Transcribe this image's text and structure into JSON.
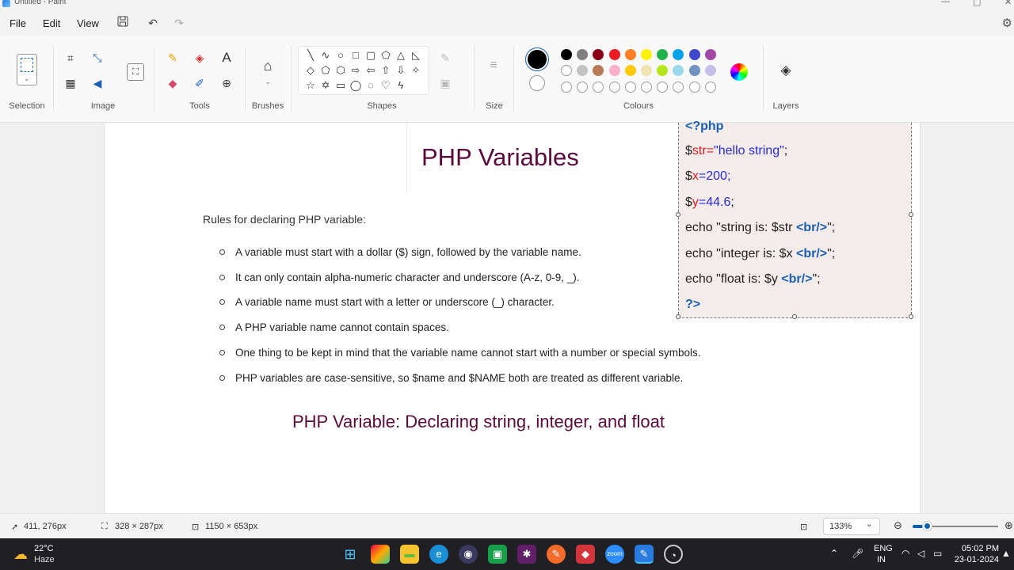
{
  "window": {
    "title": "Untitled - Paint"
  },
  "menu": {
    "file": "File",
    "edit": "Edit",
    "view": "View"
  },
  "ribbon": {
    "groups": {
      "selection": "Selection",
      "image": "Image",
      "tools": "Tools",
      "brushes": "Brushes",
      "shapes": "Shapes",
      "size": "Size",
      "colours": "Colours",
      "layers": "Layers"
    },
    "primary_color": "#000000",
    "secondary_color": "#ffffff",
    "palette_row1": [
      "#000000",
      "#7f7f7f",
      "#880015",
      "#ed1c24",
      "#ff7f27",
      "#fff200",
      "#22b14c",
      "#00a2e8",
      "#3f48cc",
      "#a349a4"
    ],
    "palette_row2": [
      "#ffffff",
      "#c3c3c3",
      "#b97a57",
      "#ffaec9",
      "#ffc90e",
      "#efe4b0",
      "#b5e61d",
      "#99d9ea",
      "#7092be",
      "#c8bfe7"
    ]
  },
  "canvas": {
    "title": "PHP Variables",
    "rules_heading": "Rules for declaring PHP variable:",
    "rules": [
      "A variable must start with a dollar ($) sign, followed by the variable name.",
      "It can only contain alpha-numeric character and underscore (A-z, 0-9, _).",
      "A variable name must start with a letter or underscore (_) character.",
      "A PHP variable name cannot contain spaces.",
      "One thing to be kept in mind that the variable name cannot start with a number or special symbols.",
      "PHP variables are case-sensitive, so $name and $NAME both are treated as different variable."
    ],
    "subtitle": "PHP Variable: Declaring string, integer, and float",
    "code": {
      "open_tag": "<?php",
      "l1_dollar": "$",
      "l1_var": "str",
      "l1_eq": "=",
      "l1_val": "\"hello string\"",
      "l1_end": ";",
      "l2_dollar": "$",
      "l2_var": "x",
      "l2_eq": "=",
      "l2_val": "200",
      "l2_end": ";",
      "l3_dollar": "$",
      "l3_var": "y",
      "l3_eq": "=",
      "l3_val": "44.6",
      "l3_end": ";",
      "l4_text": "echo \"string is: $str ",
      "l4_tag": "<br/>",
      "l4_end": "\";",
      "l5_text": "echo \"integer is: $x ",
      "l5_tag": "<br/>",
      "l5_end": "\";",
      "l6_text": "echo \"float is: $y ",
      "l6_tag": "<br/>",
      "l6_end": "\";",
      "close_tag": "?>"
    }
  },
  "status": {
    "cursor_pos": "411, 276px",
    "selection_size": "328 × 287px",
    "canvas_size": "1150 × 653px",
    "zoom": "133%"
  },
  "taskbar": {
    "weather_temp": "22°C",
    "weather_desc": "Haze",
    "lang_top": "ENG",
    "lang_bottom": "IN",
    "time": "05:02 PM",
    "date": "23-01-2024"
  }
}
